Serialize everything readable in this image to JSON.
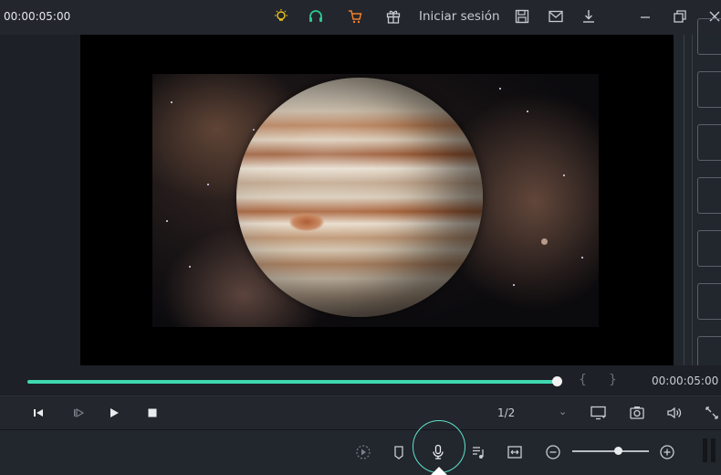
{
  "app": {
    "timecode": "00:00:05:00",
    "signin_label": "Iniciar sesión"
  },
  "colors": {
    "accent": "#3fd9b0",
    "bulb": "#f0c419",
    "support": "#2ec78f",
    "cart": "#f07d2a"
  },
  "icons": {
    "top": [
      "bulb-icon",
      "headset-icon",
      "cart-icon",
      "gift-icon",
      "save-icon",
      "mail-icon",
      "download-icon",
      "minimize-icon",
      "restore-icon",
      "close-icon"
    ],
    "transport": [
      "step-back-icon",
      "step-forward-icon",
      "play-icon",
      "stop-icon"
    ],
    "bottom": [
      "render-preview-icon",
      "marker-icon",
      "microphone-icon",
      "audio-list-icon",
      "fit-icon",
      "zoom-out-icon",
      "zoom-in-icon"
    ]
  },
  "player": {
    "progress": 1.0,
    "scrub_timecode": "00:00:05:00",
    "ratio": "1/2"
  },
  "zoom": {
    "level": 0.6
  }
}
